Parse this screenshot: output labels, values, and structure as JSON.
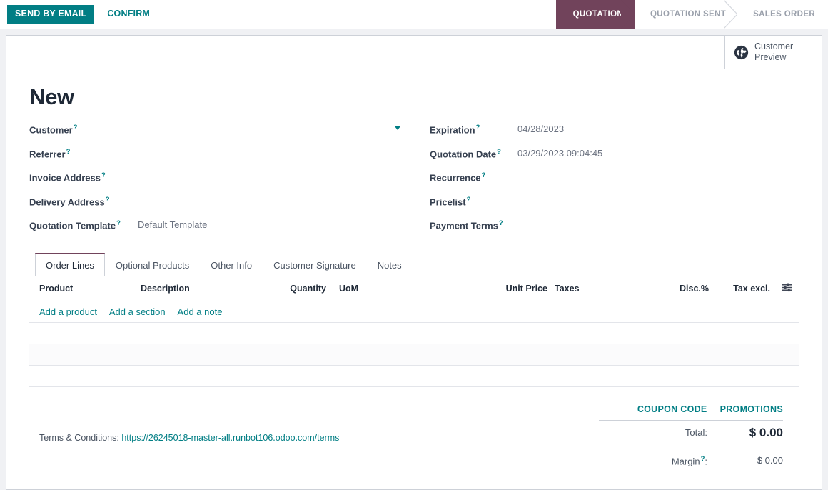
{
  "control_panel": {
    "primary_button": "SEND BY EMAIL",
    "secondary_button": "CONFIRM",
    "statusbar": [
      {
        "label": "QUOTATION",
        "active": true
      },
      {
        "label": "QUOTATION SENT",
        "active": false
      },
      {
        "label": "SALES ORDER",
        "active": false
      }
    ]
  },
  "sheet": {
    "stat_button": {
      "icon": "globe-icon",
      "line1": "Customer",
      "line2": "Preview"
    },
    "title": "New",
    "left_fields": [
      {
        "label": "Customer",
        "help": "?",
        "value": "",
        "type": "many2one_focused",
        "placeholder": ""
      },
      {
        "label": "Referrer",
        "help": "?",
        "value": "",
        "type": "text"
      },
      {
        "label": "Invoice Address",
        "help": "?",
        "value": "",
        "type": "text"
      },
      {
        "label": "Delivery Address",
        "help": "?",
        "value": "",
        "type": "text"
      },
      {
        "label": "Quotation Template",
        "help": "?",
        "value": "Default Template",
        "type": "text"
      }
    ],
    "right_fields": [
      {
        "label": "Expiration",
        "help": "?",
        "value": "04/28/2023"
      },
      {
        "label": "Quotation Date",
        "help": "?",
        "value": "03/29/2023 09:04:45"
      },
      {
        "label": "Recurrence",
        "help": "?",
        "value": ""
      },
      {
        "label": "Pricelist",
        "help": "?",
        "value": ""
      },
      {
        "label": "Payment Terms",
        "help": "?",
        "value": ""
      }
    ],
    "tabs": [
      {
        "label": "Order Lines",
        "active": true
      },
      {
        "label": "Optional Products",
        "active": false
      },
      {
        "label": "Other Info",
        "active": false
      },
      {
        "label": "Customer Signature",
        "active": false
      },
      {
        "label": "Notes",
        "active": false
      }
    ],
    "order_lines": {
      "columns": {
        "product": "Product",
        "description": "Description",
        "quantity": "Quantity",
        "uom": "UoM",
        "unit_price": "Unit Price",
        "taxes": "Taxes",
        "discount": "Disc.%",
        "tax_excl": "Tax excl.",
        "options_icon": "sliders-icon"
      },
      "rows": [],
      "add_links": [
        {
          "label": "Add a product"
        },
        {
          "label": "Add a section"
        },
        {
          "label": "Add a note"
        }
      ]
    },
    "footer": {
      "terms_label": "Terms & Conditions:",
      "terms_url": "https://26245018-master-all.runbot106.odoo.com/terms",
      "coupon_code": "COUPON CODE",
      "promotions": "PROMOTIONS",
      "total_label": "Total:",
      "total_value": "$ 0.00",
      "margin_label": "Margin",
      "margin_help": "?",
      "margin_colon": ":",
      "margin_value": "$ 0.00"
    }
  },
  "colors": {
    "primary": "#017e84",
    "status_active": "#71435b",
    "page_bg": "#f0f1f4",
    "border": "#cdd1d8"
  }
}
